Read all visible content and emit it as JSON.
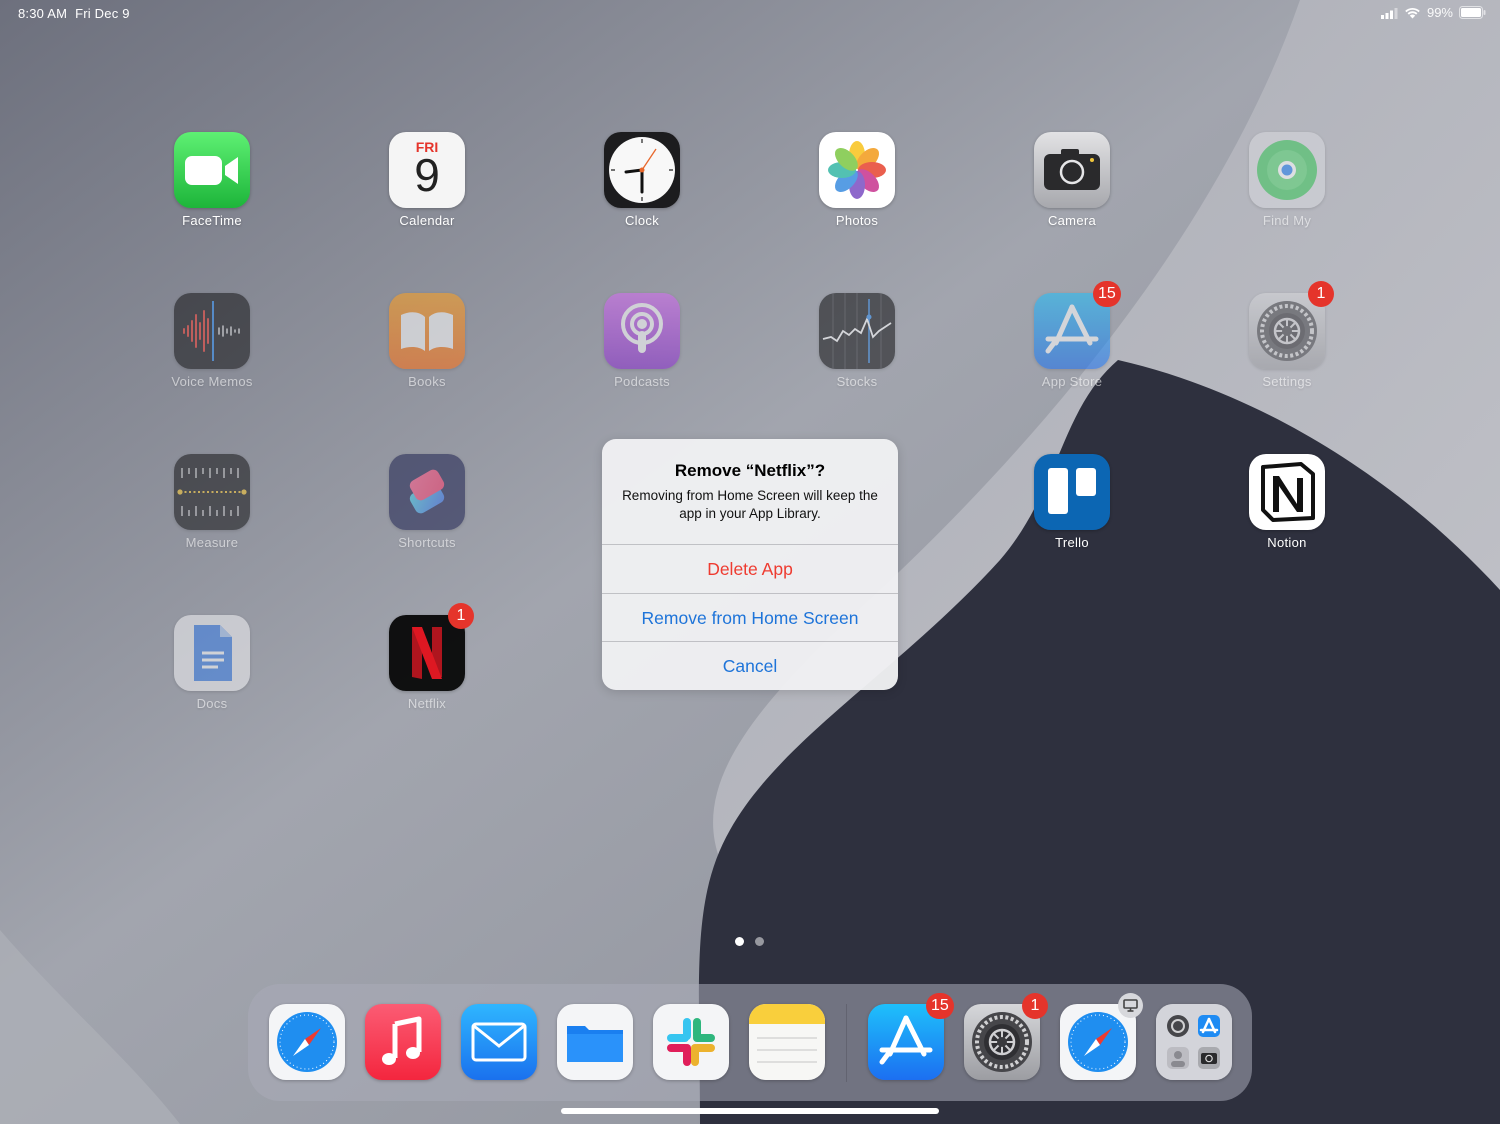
{
  "status_bar": {
    "time": "8:30 AM",
    "date": "Fri Dec 9",
    "battery": "99%"
  },
  "home_screen": {
    "apps": [
      {
        "key": "facetime",
        "label": "FaceTime",
        "icon": "video-camera-icon"
      },
      {
        "key": "calendar",
        "label": "Calendar",
        "icon": "calendar-icon",
        "calendar_day": "FRI",
        "calendar_date": "9"
      },
      {
        "key": "clock",
        "label": "Clock",
        "icon": "clock-icon"
      },
      {
        "key": "photos",
        "label": "Photos",
        "icon": "photos-flower-icon"
      },
      {
        "key": "camera",
        "label": "Camera",
        "icon": "camera-icon"
      },
      {
        "key": "findmy",
        "label": "Find My",
        "icon": "find-my-radar-icon"
      },
      {
        "key": "voicememos",
        "label": "Voice Memos",
        "icon": "waveform-icon"
      },
      {
        "key": "books",
        "label": "Books",
        "icon": "open-book-icon"
      },
      {
        "key": "podcasts",
        "label": "Podcasts",
        "icon": "podcast-icon"
      },
      {
        "key": "stocks",
        "label": "Stocks",
        "icon": "stock-chart-icon"
      },
      {
        "key": "appstore",
        "label": "App Store",
        "icon": "app-store-icon",
        "badge": "15"
      },
      {
        "key": "settings",
        "label": "Settings",
        "icon": "gear-icon",
        "badge": "1"
      },
      {
        "key": "measure",
        "label": "Measure",
        "icon": "ruler-icon"
      },
      {
        "key": "shortcuts",
        "label": "Shortcuts",
        "icon": "shortcuts-icon"
      },
      {
        "key": "trello",
        "label": "Trello",
        "icon": "trello-board-icon"
      },
      {
        "key": "notion",
        "label": "Notion",
        "icon": "notion-n-icon"
      },
      {
        "key": "docs",
        "label": "Docs",
        "icon": "document-icon"
      },
      {
        "key": "netflix",
        "label": "Netflix",
        "icon": "netflix-n-icon",
        "badge": "1"
      }
    ]
  },
  "alert": {
    "title": "Remove “Netflix”?",
    "message": "Removing from Home Screen will keep the app in your App Library.",
    "buttons": {
      "delete": "Delete App",
      "remove": "Remove from Home Screen",
      "cancel": "Cancel"
    }
  },
  "page_indicator": {
    "pages": 2,
    "current": 1
  },
  "dock": {
    "apps": [
      {
        "key": "safari",
        "icon": "compass-icon"
      },
      {
        "key": "music",
        "icon": "music-note-icon"
      },
      {
        "key": "mail",
        "icon": "envelope-icon"
      },
      {
        "key": "files",
        "icon": "folder-icon"
      },
      {
        "key": "slack",
        "icon": "slack-icon"
      },
      {
        "key": "notes",
        "icon": "notes-icon"
      }
    ],
    "recent_apps": [
      {
        "key": "appstore",
        "icon": "app-store-icon",
        "badge": "15"
      },
      {
        "key": "settings",
        "icon": "gear-icon",
        "badge": "1"
      },
      {
        "key": "safari-handoff",
        "icon": "compass-icon",
        "handoff": "monitor-icon"
      },
      {
        "key": "app-library",
        "icon": "app-library-icon"
      }
    ]
  },
  "colors": {
    "badge": "#e5342b",
    "alert_action_blue": "#1e74d9",
    "alert_destructive_red": "#ee3b30",
    "wallpaper_light": "#9fa2ab",
    "wallpaper_dark": "#2e303e"
  }
}
